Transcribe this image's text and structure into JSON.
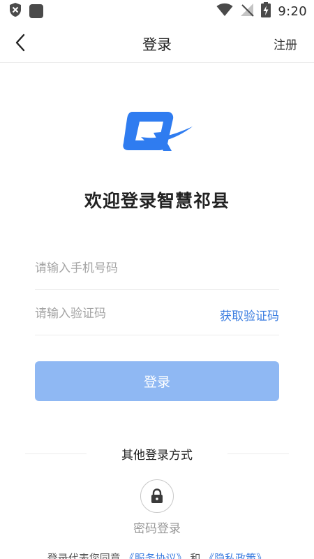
{
  "status_bar": {
    "time": "9:20"
  },
  "header": {
    "title": "登录",
    "register": "注册"
  },
  "welcome": "欢迎登录智慧祁县",
  "form": {
    "phone_placeholder": "请输入手机号码",
    "code_placeholder": "请输入验证码",
    "get_code": "获取验证码",
    "login_button": "登录"
  },
  "other": {
    "label": "其他登录方式",
    "password_login": "密码登录"
  },
  "agreement": {
    "prefix": "登录代表您同意",
    "service": "《服务协议》",
    "and": "和",
    "privacy": "《隐私政策》"
  },
  "colors": {
    "accent": "#3b7de0",
    "button_disabled": "#8fb8f3",
    "logo_blue": "#2f7cf0"
  }
}
